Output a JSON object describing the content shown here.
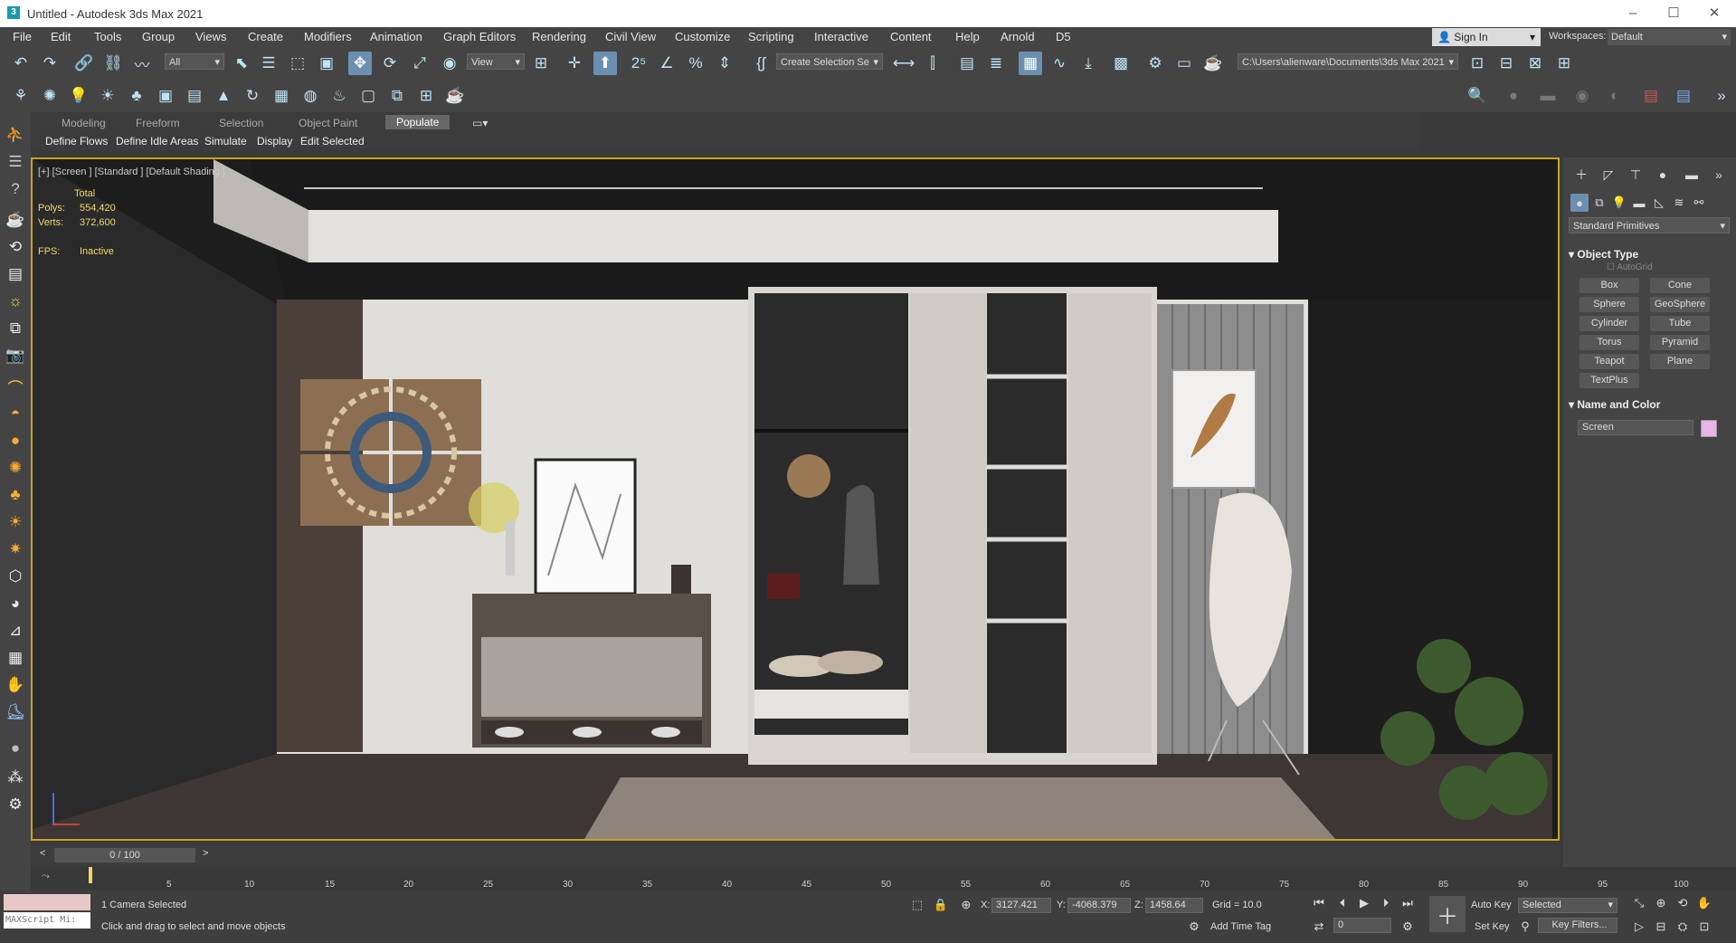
{
  "window": {
    "title": "Untitled - Autodesk 3ds Max 2021",
    "app_icon_letter": "3"
  },
  "menu": [
    "File",
    "Edit",
    "Tools",
    "Group",
    "Views",
    "Create",
    "Modifiers",
    "Animation",
    "Graph Editors",
    "Rendering",
    "Civil View",
    "Customize",
    "Scripting",
    "Interactive",
    "Content",
    "Help",
    "Arnold",
    "D5"
  ],
  "account": {
    "sign_in": "Sign In",
    "workspaces_label": "Workspaces:",
    "workspace": "Default"
  },
  "toolbar": {
    "selection_filter": "All",
    "reference_coord": "View",
    "named_selection": "Create Selection Se",
    "project_path": "C:\\Users\\alienware\\Documents\\3ds Max 2021"
  },
  "ribbon": {
    "tabs": [
      "Modeling",
      "Freeform",
      "Selection",
      "Object Paint",
      "Populate"
    ],
    "active_tab": "Populate",
    "subitems": [
      "Define Flows",
      "Define Idle Areas",
      "Simulate",
      "Display",
      "Edit Selected"
    ]
  },
  "viewport": {
    "label": "[+] [Screen ] [Standard ] [Default Shading ]",
    "stats": {
      "header": "Total",
      "polys_label": "Polys:",
      "polys": "554,420",
      "verts_label": "Verts:",
      "verts": "372,600",
      "fps_label": "FPS:",
      "fps": "Inactive"
    }
  },
  "command_panel": {
    "category": "Standard Primitives",
    "object_type_title": "Object Type",
    "autogrid": "AutoGrid",
    "buttons": [
      "Box",
      "Cone",
      "Sphere",
      "GeoSphere",
      "Cylinder",
      "Tube",
      "Torus",
      "Pyramid",
      "Teapot",
      "Plane",
      "TextPlus"
    ],
    "name_color_title": "Name and Color",
    "object_name": "Screen",
    "object_color": "#e8b4e8"
  },
  "timeline": {
    "frame": "0 / 100",
    "ticks": [
      "5",
      "10",
      "15",
      "20",
      "25",
      "30",
      "35",
      "40",
      "45",
      "50",
      "55",
      "60",
      "65",
      "70",
      "75",
      "80",
      "85",
      "90",
      "95",
      "100"
    ]
  },
  "status": {
    "maxscript": "MAXScript Mi:",
    "selection": "1 Camera Selected",
    "prompt": "Click and drag to select and move objects",
    "x_label": "X:",
    "x": "3127.421",
    "y_label": "Y:",
    "y": "-4068.379",
    "z_label": "Z:",
    "z": "1458.64",
    "grid": "Grid = 10.0",
    "add_time_tag": "Add Time Tag",
    "auto_key": "Auto Key",
    "set_key": "Set Key",
    "key_mode": "Selected",
    "key_filters": "Key Filters...",
    "current_frame": "0"
  }
}
